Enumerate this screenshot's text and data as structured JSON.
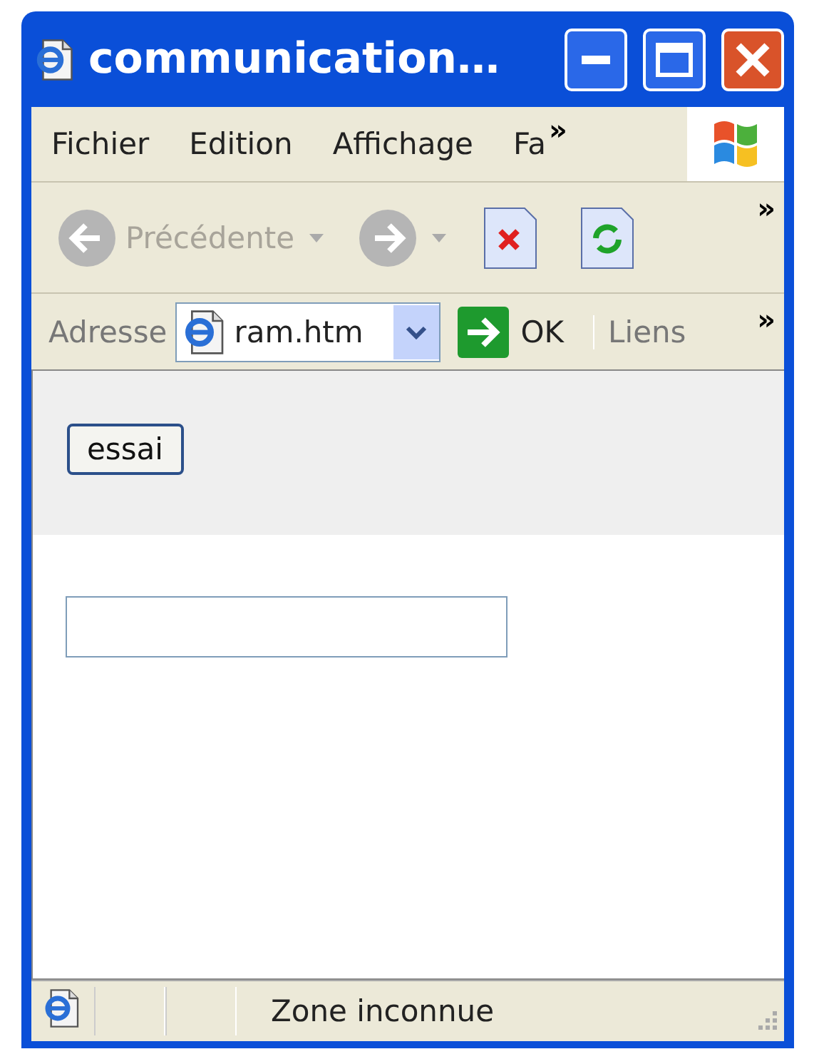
{
  "window": {
    "title": "communication…"
  },
  "menu": {
    "items": [
      "Fichier",
      "Edition",
      "Affichage",
      "Fa"
    ],
    "more": "»"
  },
  "toolbar": {
    "back": {
      "label": "Précédente",
      "disabled": true
    },
    "forward": {
      "disabled": true
    },
    "more": "»"
  },
  "address_bar": {
    "label": "Adresse",
    "value": "ram.htm",
    "go": "OK",
    "links": "Liens",
    "more": "»"
  },
  "page": {
    "button": "essai"
  },
  "status_bar": {
    "text": "Zone inconnue"
  }
}
